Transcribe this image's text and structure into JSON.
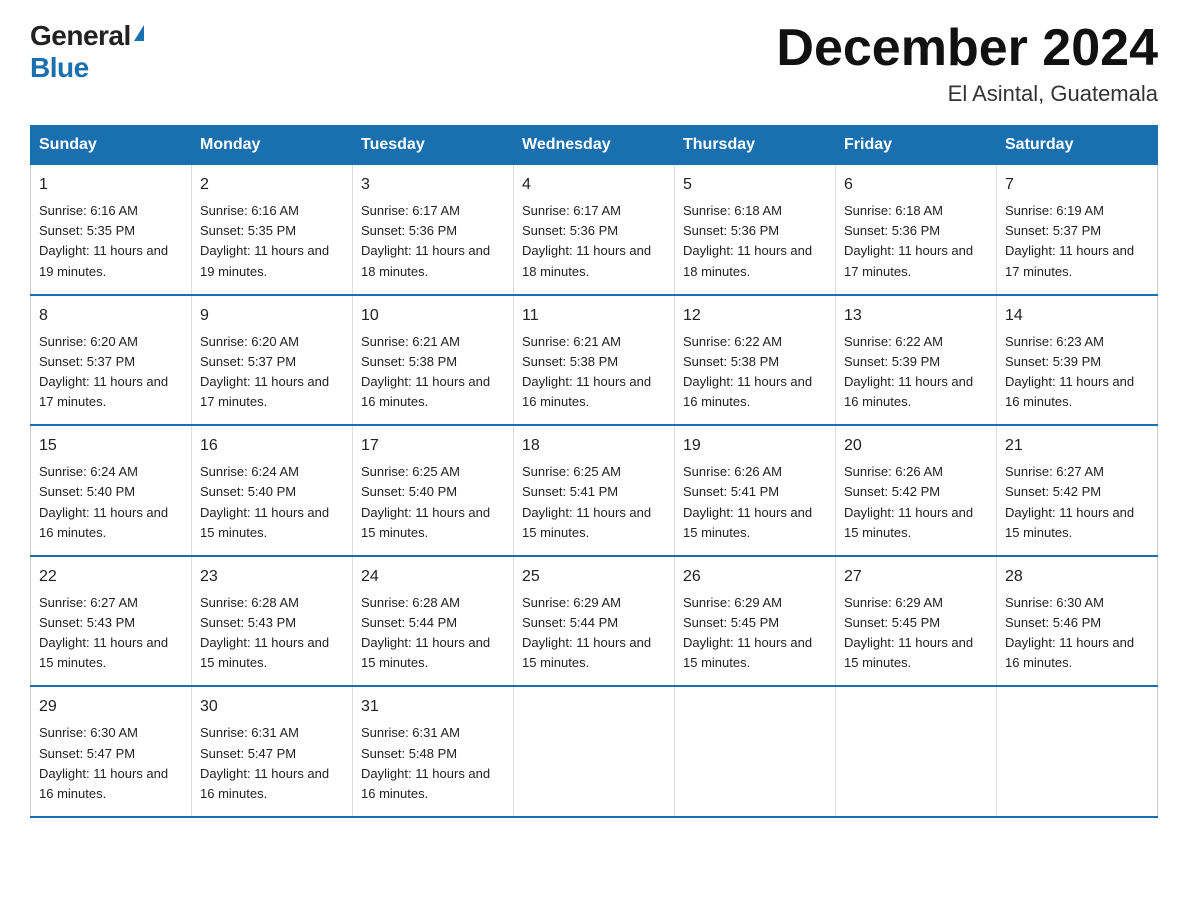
{
  "header": {
    "logo_general": "General",
    "logo_blue": "Blue",
    "month_title": "December 2024",
    "location": "El Asintal, Guatemala"
  },
  "days_of_week": [
    "Sunday",
    "Monday",
    "Tuesday",
    "Wednesday",
    "Thursday",
    "Friday",
    "Saturday"
  ],
  "weeks": [
    [
      {
        "day": "1",
        "sunrise": "6:16 AM",
        "sunset": "5:35 PM",
        "daylight": "11 hours and 19 minutes."
      },
      {
        "day": "2",
        "sunrise": "6:16 AM",
        "sunset": "5:35 PM",
        "daylight": "11 hours and 19 minutes."
      },
      {
        "day": "3",
        "sunrise": "6:17 AM",
        "sunset": "5:36 PM",
        "daylight": "11 hours and 18 minutes."
      },
      {
        "day": "4",
        "sunrise": "6:17 AM",
        "sunset": "5:36 PM",
        "daylight": "11 hours and 18 minutes."
      },
      {
        "day": "5",
        "sunrise": "6:18 AM",
        "sunset": "5:36 PM",
        "daylight": "11 hours and 18 minutes."
      },
      {
        "day": "6",
        "sunrise": "6:18 AM",
        "sunset": "5:36 PM",
        "daylight": "11 hours and 17 minutes."
      },
      {
        "day": "7",
        "sunrise": "6:19 AM",
        "sunset": "5:37 PM",
        "daylight": "11 hours and 17 minutes."
      }
    ],
    [
      {
        "day": "8",
        "sunrise": "6:20 AM",
        "sunset": "5:37 PM",
        "daylight": "11 hours and 17 minutes."
      },
      {
        "day": "9",
        "sunrise": "6:20 AM",
        "sunset": "5:37 PM",
        "daylight": "11 hours and 17 minutes."
      },
      {
        "day": "10",
        "sunrise": "6:21 AM",
        "sunset": "5:38 PM",
        "daylight": "11 hours and 16 minutes."
      },
      {
        "day": "11",
        "sunrise": "6:21 AM",
        "sunset": "5:38 PM",
        "daylight": "11 hours and 16 minutes."
      },
      {
        "day": "12",
        "sunrise": "6:22 AM",
        "sunset": "5:38 PM",
        "daylight": "11 hours and 16 minutes."
      },
      {
        "day": "13",
        "sunrise": "6:22 AM",
        "sunset": "5:39 PM",
        "daylight": "11 hours and 16 minutes."
      },
      {
        "day": "14",
        "sunrise": "6:23 AM",
        "sunset": "5:39 PM",
        "daylight": "11 hours and 16 minutes."
      }
    ],
    [
      {
        "day": "15",
        "sunrise": "6:24 AM",
        "sunset": "5:40 PM",
        "daylight": "11 hours and 16 minutes."
      },
      {
        "day": "16",
        "sunrise": "6:24 AM",
        "sunset": "5:40 PM",
        "daylight": "11 hours and 15 minutes."
      },
      {
        "day": "17",
        "sunrise": "6:25 AM",
        "sunset": "5:40 PM",
        "daylight": "11 hours and 15 minutes."
      },
      {
        "day": "18",
        "sunrise": "6:25 AM",
        "sunset": "5:41 PM",
        "daylight": "11 hours and 15 minutes."
      },
      {
        "day": "19",
        "sunrise": "6:26 AM",
        "sunset": "5:41 PM",
        "daylight": "11 hours and 15 minutes."
      },
      {
        "day": "20",
        "sunrise": "6:26 AM",
        "sunset": "5:42 PM",
        "daylight": "11 hours and 15 minutes."
      },
      {
        "day": "21",
        "sunrise": "6:27 AM",
        "sunset": "5:42 PM",
        "daylight": "11 hours and 15 minutes."
      }
    ],
    [
      {
        "day": "22",
        "sunrise": "6:27 AM",
        "sunset": "5:43 PM",
        "daylight": "11 hours and 15 minutes."
      },
      {
        "day": "23",
        "sunrise": "6:28 AM",
        "sunset": "5:43 PM",
        "daylight": "11 hours and 15 minutes."
      },
      {
        "day": "24",
        "sunrise": "6:28 AM",
        "sunset": "5:44 PM",
        "daylight": "11 hours and 15 minutes."
      },
      {
        "day": "25",
        "sunrise": "6:29 AM",
        "sunset": "5:44 PM",
        "daylight": "11 hours and 15 minutes."
      },
      {
        "day": "26",
        "sunrise": "6:29 AM",
        "sunset": "5:45 PM",
        "daylight": "11 hours and 15 minutes."
      },
      {
        "day": "27",
        "sunrise": "6:29 AM",
        "sunset": "5:45 PM",
        "daylight": "11 hours and 15 minutes."
      },
      {
        "day": "28",
        "sunrise": "6:30 AM",
        "sunset": "5:46 PM",
        "daylight": "11 hours and 16 minutes."
      }
    ],
    [
      {
        "day": "29",
        "sunrise": "6:30 AM",
        "sunset": "5:47 PM",
        "daylight": "11 hours and 16 minutes."
      },
      {
        "day": "30",
        "sunrise": "6:31 AM",
        "sunset": "5:47 PM",
        "daylight": "11 hours and 16 minutes."
      },
      {
        "day": "31",
        "sunrise": "6:31 AM",
        "sunset": "5:48 PM",
        "daylight": "11 hours and 16 minutes."
      },
      null,
      null,
      null,
      null
    ]
  ]
}
